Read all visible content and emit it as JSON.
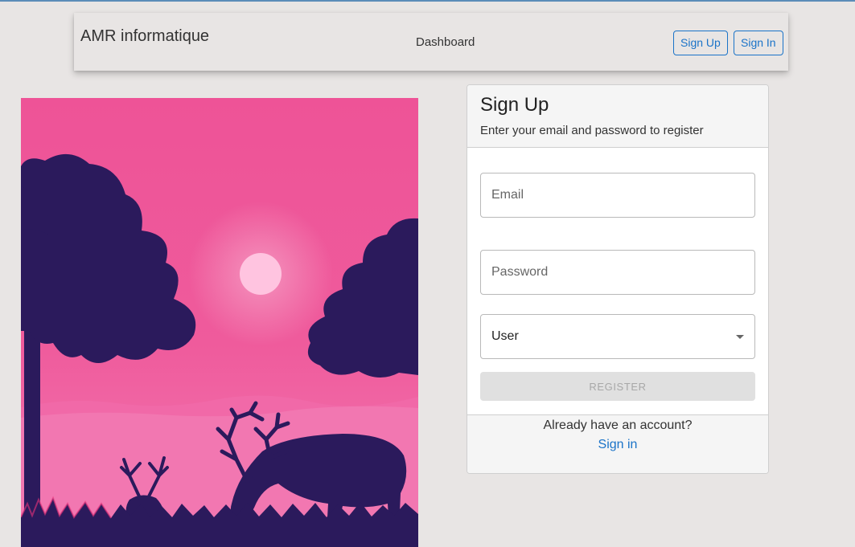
{
  "navbar": {
    "brand": "AMR informatique",
    "dashboard_link": "Dashboard",
    "signup_button": "Sign Up",
    "signin_button": "Sign In"
  },
  "illustration": {
    "icon": "sunset-deer-illustration",
    "colors": {
      "sky": "#ef5b9c",
      "silhouette": "#2b1a5c",
      "sun": "#ffc4e0"
    }
  },
  "card": {
    "title": "Sign Up",
    "subtitle": "Enter your email and password to register",
    "email_placeholder": "Email",
    "password_placeholder": "Password",
    "role_selected": "User",
    "register_button": "REGISTER",
    "footer_text": "Already have an account?",
    "footer_link": "Sign in"
  },
  "colors": {
    "accent": "#1a73c8",
    "background": "#e8e5e4"
  }
}
